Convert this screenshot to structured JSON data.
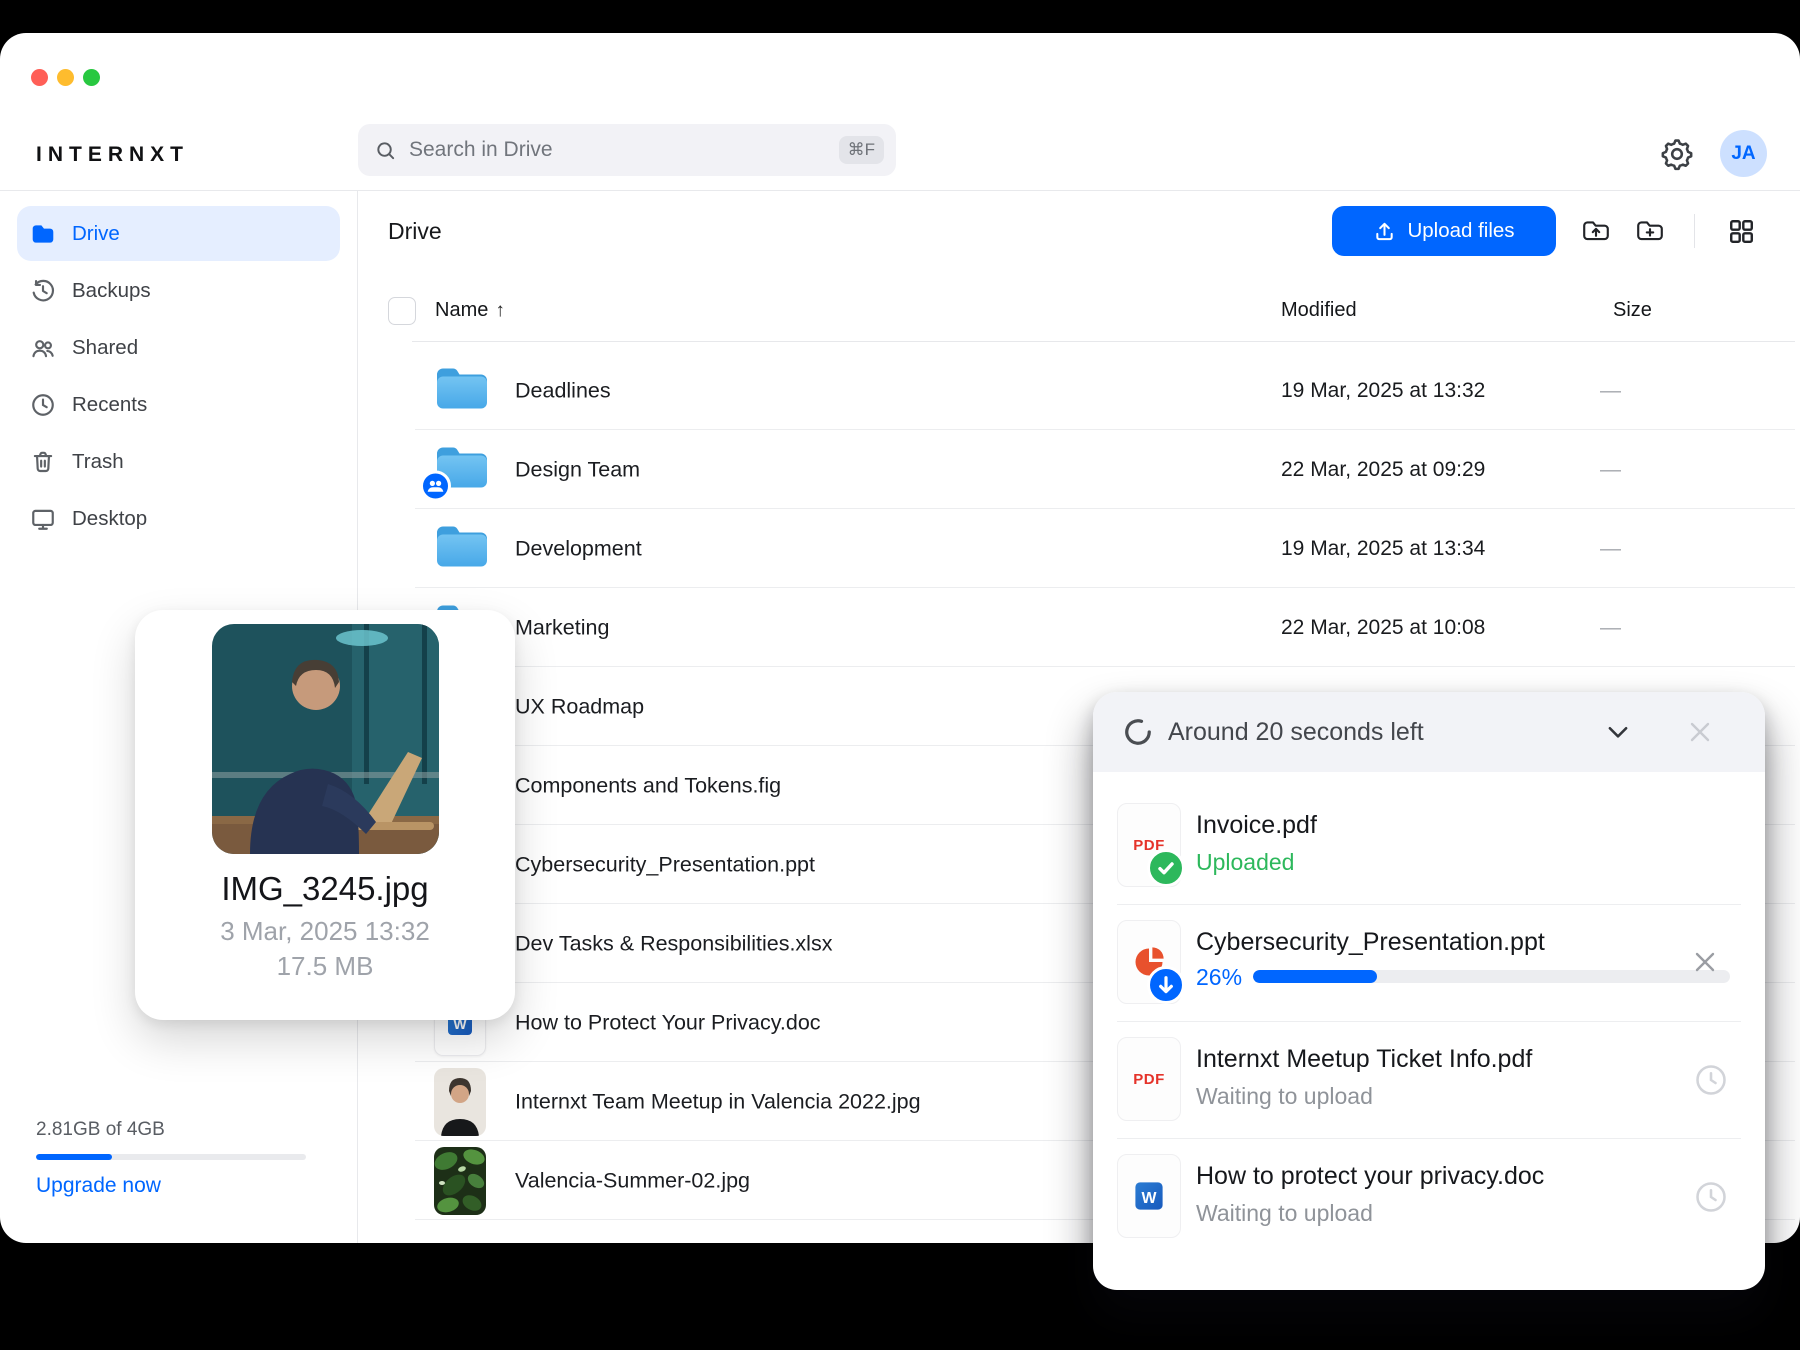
{
  "window": {
    "traffic_lights": [
      "#FF5F57",
      "#FEBC2E",
      "#28C840"
    ]
  },
  "brand": {
    "logo": "INTERNXT",
    "accent": "#0066FF"
  },
  "topbar": {
    "search_placeholder": "Search in Drive",
    "search_shortcut": "⌘F",
    "avatar_initials": "JA"
  },
  "sidebar": {
    "items": [
      {
        "label": "Drive"
      },
      {
        "label": "Backups"
      },
      {
        "label": "Shared"
      },
      {
        "label": "Recents"
      },
      {
        "label": "Trash"
      },
      {
        "label": "Desktop"
      }
    ],
    "storage": {
      "usage_text": "2.81GB of 4GB",
      "percent": 28,
      "upgrade_label": "Upgrade now"
    }
  },
  "main": {
    "title": "Drive",
    "upload_button": "Upload files",
    "table": {
      "columns": {
        "name": "Name",
        "modified": "Modified",
        "size": "Size"
      },
      "sort_arrow": "↑",
      "rows": [
        {
          "name": "Deadlines",
          "modified": "19 Mar, 2025 at 13:32",
          "size": "—"
        },
        {
          "name": "Design Team",
          "modified": "22 Mar, 2025 at 09:29",
          "size": "—"
        },
        {
          "name": "Development",
          "modified": "19 Mar, 2025 at 13:34",
          "size": "—"
        },
        {
          "name": "Marketing",
          "modified": "22 Mar, 2025 at 10:08",
          "size": "—"
        },
        {
          "name": "UX Roadmap",
          "modified": "",
          "size": ""
        },
        {
          "name": "Components and Tokens.fig",
          "modified": "",
          "size": ""
        },
        {
          "name": "Cybersecurity_Presentation.ppt",
          "modified": "",
          "size": ""
        },
        {
          "name": "Dev Tasks & Responsibilities.xlsx",
          "modified": "",
          "size": ""
        },
        {
          "name": "How to Protect Your Privacy.doc",
          "modified": "",
          "size": ""
        },
        {
          "name": "Internxt Team Meetup in Valencia 2022.jpg",
          "modified": "",
          "size": ""
        },
        {
          "name": "Valencia-Summer-02.jpg",
          "modified": "",
          "size": ""
        }
      ]
    }
  },
  "preview_card": {
    "filename": "IMG_3245.jpg",
    "date": "3 Mar, 2025 13:32",
    "size": "17.5 MB"
  },
  "upload_panel": {
    "title": "Around 20 seconds left",
    "items": [
      {
        "name": "Invoice.pdf",
        "status": "Uploaded",
        "icon": "pdf"
      },
      {
        "name": "Cybersecurity_Presentation.ppt",
        "status": "26%",
        "percent": 26,
        "icon": "ppt"
      },
      {
        "name": "Internxt Meetup Ticket Info.pdf",
        "status": "Waiting to upload",
        "icon": "pdf"
      },
      {
        "name": "How to protect your privacy.doc",
        "status": "Waiting to upload",
        "icon": "doc"
      }
    ]
  },
  "colors": {
    "status_done": "#2DB85C",
    "progress": "#0066FF",
    "waiting": "#8F9399"
  }
}
